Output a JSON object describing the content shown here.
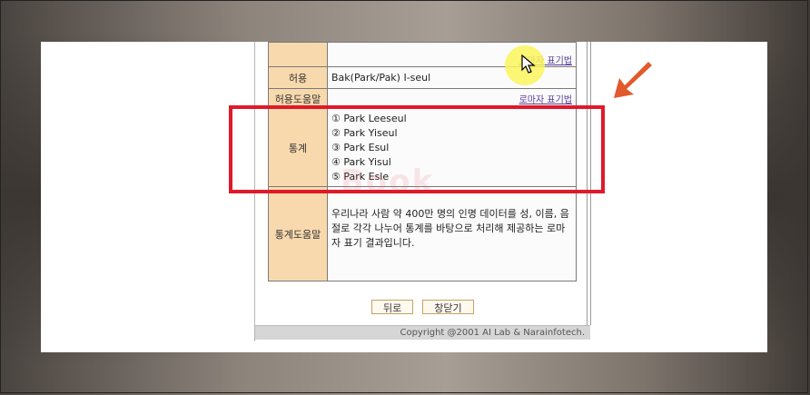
{
  "rows": {
    "top_help": "로마자 표기법",
    "allowed_label": "허용",
    "allowed_value": "Bak(Park/Pak) I-seul",
    "allowed_help_label": "허용도움말",
    "allowed_help_link": "로마자 표기법",
    "stats_label": "통계",
    "stats_items": [
      "① Park Leeseul",
      "② Park Yiseul",
      "③ Park Esul",
      "④ Park Yisul",
      "⑤ Park Esle"
    ],
    "stats_help_label": "통계도움말",
    "stats_help_text": "우리나라 사람 약 400만 명의 인명 데이터를 성, 이름, 음절로 각각 나누어 통계를 바탕으로 처리해 제공하는 로마자 표기 결과입니다."
  },
  "buttons": {
    "back": "뒤로",
    "close": "창닫기"
  },
  "footer": "Copyright @2001 AI Lab & Narainfotech.",
  "watermark": "Book",
  "colors": {
    "label_bg": "#f8d9ad",
    "highlight": "#e0192a",
    "arrow": "#e05a2b",
    "cursor_glow": "#faf55a"
  }
}
